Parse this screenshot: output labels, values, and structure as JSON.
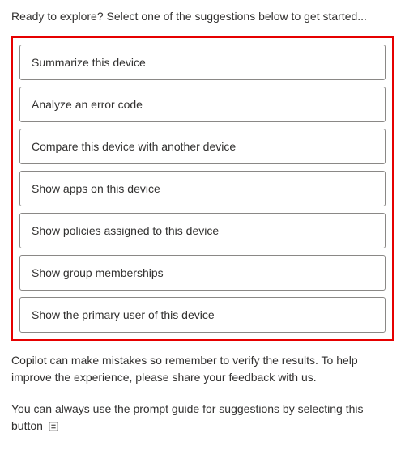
{
  "intro": "Ready to explore? Select one of the suggestions below to get started...",
  "suggestions": {
    "items": [
      {
        "label": "Summarize this device"
      },
      {
        "label": "Analyze an error code"
      },
      {
        "label": "Compare this device with another device"
      },
      {
        "label": "Show apps on this device"
      },
      {
        "label": "Show policies assigned to this device"
      },
      {
        "label": "Show group memberships"
      },
      {
        "label": "Show the primary user of this device"
      }
    ]
  },
  "disclaimer": "Copilot can make mistakes so remember to verify the results. To help improve the experience, please share your feedback with us.",
  "prompt_guide": "You can always use the prompt guide for suggestions by selecting this button "
}
